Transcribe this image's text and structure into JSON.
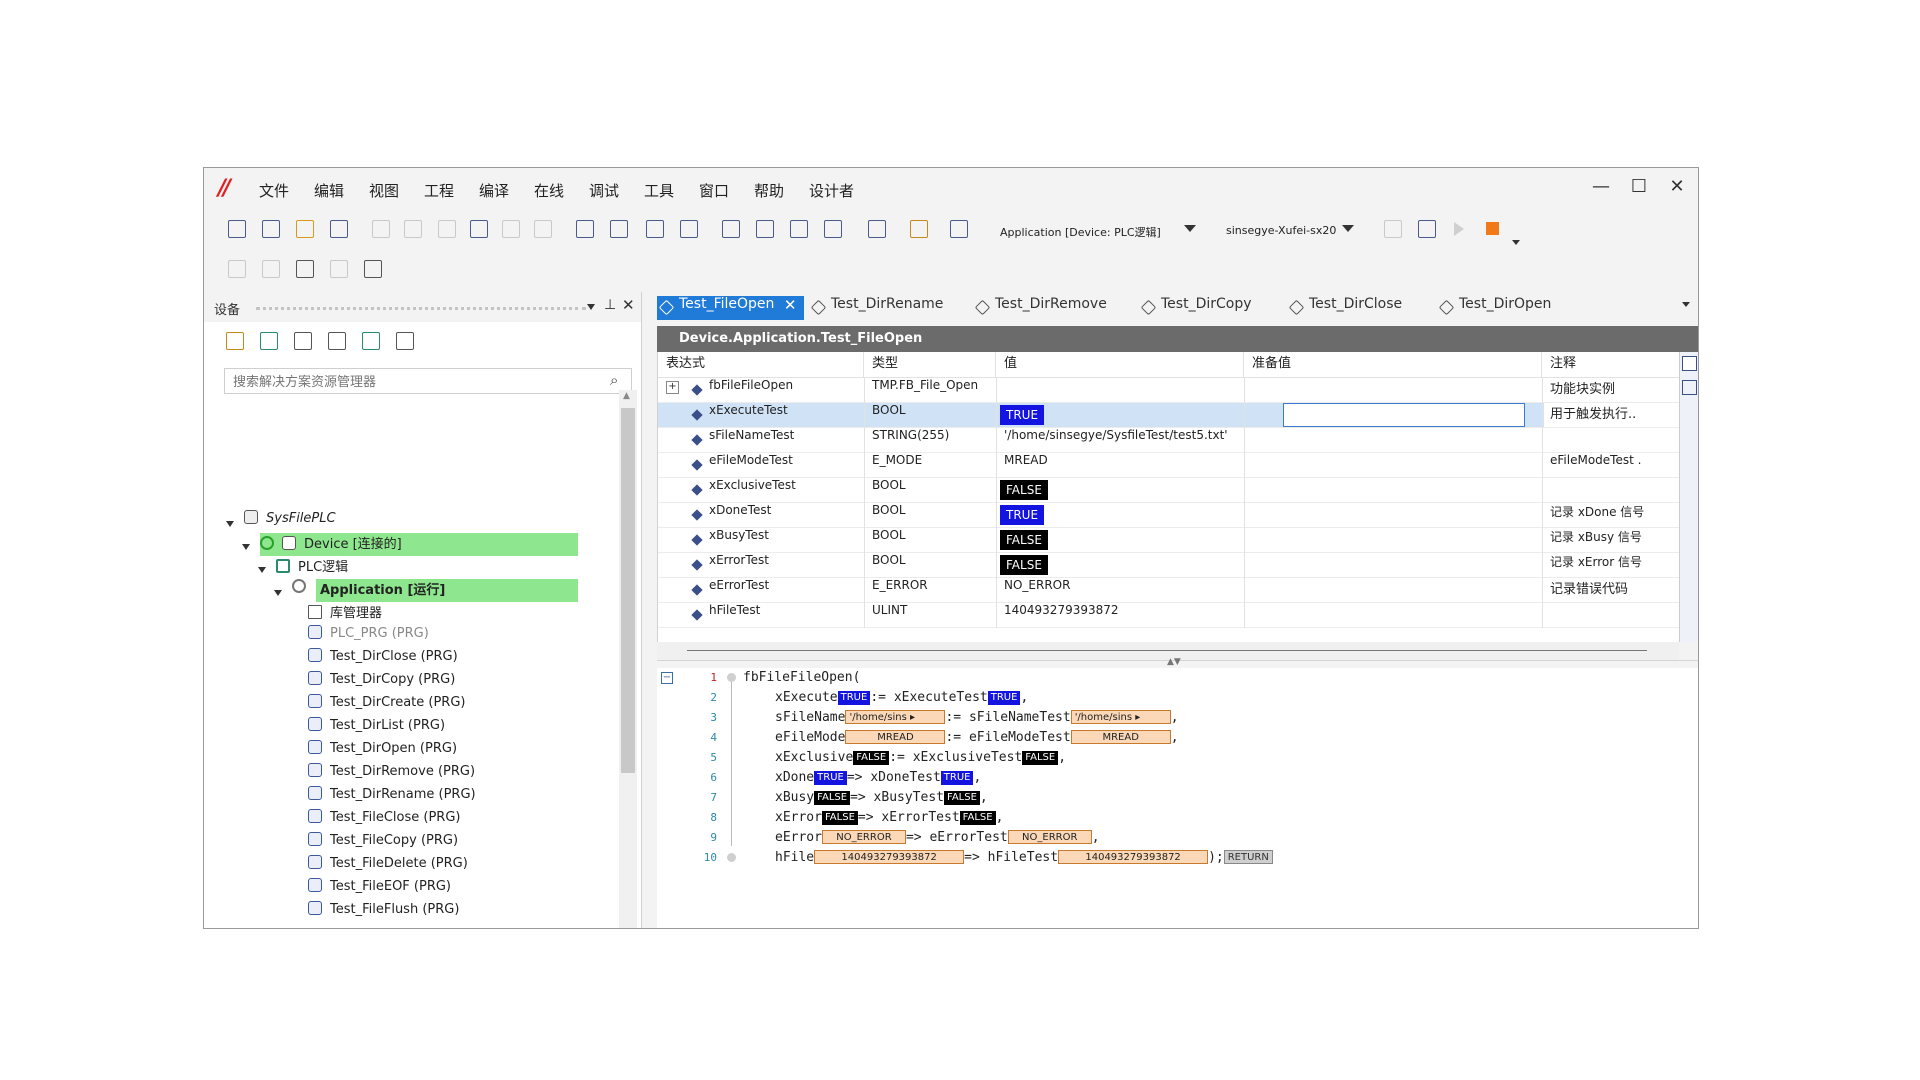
{
  "menu": [
    "文件",
    "编辑",
    "视图",
    "工程",
    "编译",
    "在线",
    "调试",
    "工具",
    "窗口",
    "帮助",
    "设计者"
  ],
  "logo_text": "//",
  "window_controls": {
    "minimize": "—",
    "maximize": "☐",
    "close": "✕"
  },
  "toolbar": {
    "application_select": "Application [Device: PLC逻辑]",
    "device_select": "sinsegye-Xufei-sx20"
  },
  "devices": {
    "title": "设备",
    "search_placeholder": "搜索解决方案资源管理器",
    "tree": {
      "root": "SysFilePLC",
      "device": "Device [连接的]",
      "plc": "PLC逻辑",
      "app": "Application [运行]",
      "library": "库管理器",
      "items": [
        "PLC_PRG (PRG)",
        "Test_DirClose (PRG)",
        "Test_DirCopy (PRG)",
        "Test_DirCreate (PRG)",
        "Test_DirList (PRG)",
        "Test_DirOpen (PRG)",
        "Test_DirRemove (PRG)",
        "Test_DirRename (PRG)",
        "Test_FileClose (PRG)",
        "Test_FileCopy (PRG)",
        "Test_FileDelete (PRG)",
        "Test_FileEOF (PRG)",
        "Test_FileFlush (PRG)"
      ]
    }
  },
  "tabs": [
    "Test_FileOpen",
    "Test_DirRename",
    "Test_DirRemove",
    "Test_DirCopy",
    "Test_DirClose",
    "Test_DirOpen"
  ],
  "object_path": "Device.Application.Test_FileOpen",
  "watch": {
    "headers": {
      "expr": "表达式",
      "type": "类型",
      "value": "值",
      "prepared": "准备值",
      "comment": "注释"
    },
    "rows": [
      {
        "expr": "fbFileFileOpen",
        "type": "TMP.FB_File_Open",
        "value": "",
        "comment": "功能块实例"
      },
      {
        "expr": "xExecuteTest",
        "type": "BOOL",
        "value": "TRUE",
        "comment": "用于触发执行.."
      },
      {
        "expr": "sFileNameTest",
        "type": "STRING(255)",
        "value": "'/home/sinsegye/SysfileTest/test5.txt'",
        "comment": ""
      },
      {
        "expr": "eFileModeTest",
        "type": "E_MODE",
        "value": "MREAD",
        "comment": "eFileModeTest ."
      },
      {
        "expr": "xExclusiveTest",
        "type": "BOOL",
        "value": "FALSE",
        "comment": ""
      },
      {
        "expr": "xDoneTest",
        "type": "BOOL",
        "value": "TRUE",
        "comment": "记录 xDone 信号"
      },
      {
        "expr": "xBusyTest",
        "type": "BOOL",
        "value": "FALSE",
        "comment": "记录 xBusy 信号"
      },
      {
        "expr": "xErrorTest",
        "type": "BOOL",
        "value": "FALSE",
        "comment": "记录 xError 信号"
      },
      {
        "expr": "eErrorTest",
        "type": "E_ERROR",
        "value": "NO_ERROR",
        "comment": "记录错误代码"
      },
      {
        "expr": "hFileTest",
        "type": "ULINT",
        "value": "140493279393872",
        "comment": ""
      }
    ]
  },
  "code": {
    "line_numbers": [
      "1",
      "2",
      "3",
      "4",
      "5",
      "6",
      "7",
      "8",
      "9",
      "10"
    ],
    "l1": "fbFileFileOpen(",
    "l2": {
      "a": "xExecute",
      "v1": "TRUE",
      "op": ":=",
      "b": "xExecuteTest",
      "v2": "TRUE",
      "end": ","
    },
    "l3": {
      "a": "sFileName",
      "v1": "'/home/sins",
      "op": ":=",
      "b": "sFileNameTest",
      "v2": "'/home/sins",
      "end": ","
    },
    "l4": {
      "a": "eFileMode",
      "v1": "MREAD",
      "op": ":=",
      "b": "eFileModeTest",
      "v2": "MREAD",
      "end": ","
    },
    "l5": {
      "a": "xExclusive",
      "v1": "FALSE",
      "op": ":=",
      "b": "xExclusiveTest",
      "v2": "FALSE",
      "end": ","
    },
    "l6": {
      "a": "xDone",
      "v1": "TRUE",
      "op": "=>",
      "b": "xDoneTest",
      "v2": "TRUE",
      "end": ","
    },
    "l7": {
      "a": "xBusy",
      "v1": "FALSE",
      "op": "=>",
      "b": "xBusyTest",
      "v2": "FALSE",
      "end": ","
    },
    "l8": {
      "a": "xError",
      "v1": "FALSE",
      "op": "=>",
      "b": "xErrorTest",
      "v2": "FALSE",
      "end": ","
    },
    "l9": {
      "a": "eError",
      "v1": "NO_ERROR",
      "op": "=>",
      "b": "eErrorTest",
      "v2": "NO_ERROR",
      "end": ","
    },
    "l10": {
      "a": "hFile",
      "v1": "140493279393872",
      "op": "=>",
      "b": "hFileTest",
      "v2": "140493279393872",
      "end": ");",
      "ret": "RETURN"
    }
  },
  "colors": {
    "accent": "#1f7ad8",
    "highlight": "#8ee68e",
    "true_bg": "#1414e0",
    "false_bg": "#000000"
  }
}
